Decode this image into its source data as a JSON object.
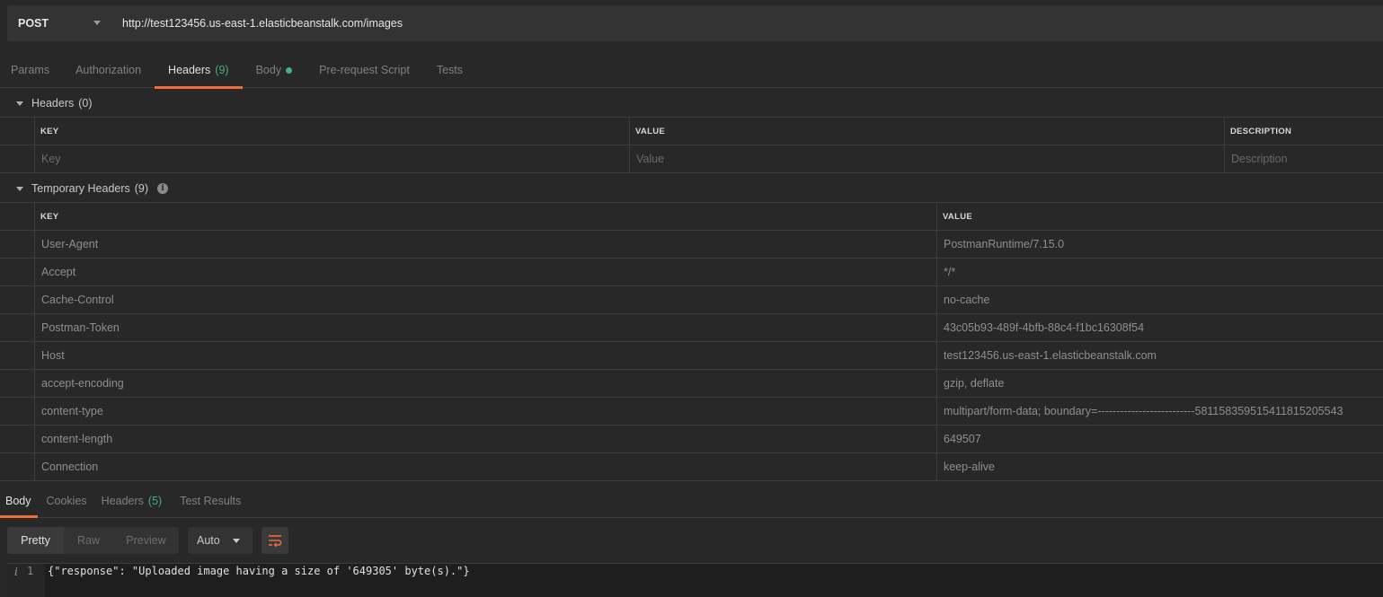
{
  "request": {
    "method": "POST",
    "url": "http://test123456.us-east-1.elasticbeanstalk.com/images"
  },
  "request_tabs": [
    {
      "label": "Params"
    },
    {
      "label": "Authorization"
    },
    {
      "label": "Headers",
      "count": "(9)",
      "active": true
    },
    {
      "label": "Body",
      "indicator": "green-dot"
    },
    {
      "label": "Pre-request Script"
    },
    {
      "label": "Tests"
    }
  ],
  "headers_section": {
    "title": "Headers",
    "count": "(0)",
    "columns": [
      "KEY",
      "VALUE",
      "DESCRIPTION"
    ],
    "placeholders": {
      "key": "Key",
      "value": "Value",
      "description": "Description"
    }
  },
  "temp_headers_section": {
    "title": "Temporary Headers",
    "count": "(9)",
    "info_icon": "info-icon",
    "columns": [
      "KEY",
      "VALUE"
    ],
    "rows": [
      {
        "key": "User-Agent",
        "value": "PostmanRuntime/7.15.0"
      },
      {
        "key": "Accept",
        "value": "*/*"
      },
      {
        "key": "Cache-Control",
        "value": "no-cache"
      },
      {
        "key": "Postman-Token",
        "value": "43c05b93-489f-4bfb-88c4-f1bc16308f54"
      },
      {
        "key": "Host",
        "value": "test123456.us-east-1.elasticbeanstalk.com"
      },
      {
        "key": "accept-encoding",
        "value": "gzip, deflate"
      },
      {
        "key": "content-type",
        "value": "multipart/form-data; boundary=--------------------------581158359515411815205543"
      },
      {
        "key": "content-length",
        "value": "649507"
      },
      {
        "key": "Connection",
        "value": "keep-alive"
      }
    ]
  },
  "response_tabs": [
    {
      "label": "Body",
      "active": true
    },
    {
      "label": "Cookies"
    },
    {
      "label": "Headers",
      "count": "(5)"
    },
    {
      "label": "Test Results"
    }
  ],
  "response_toolbar": {
    "views": [
      "Pretty",
      "Raw",
      "Preview"
    ],
    "active_view": "Pretty",
    "format": "Auto",
    "wrap_icon": "wrap-lines-icon"
  },
  "response_body": {
    "line_marker": "i",
    "line_number": "1",
    "line": "{\"response\": \"Uploaded image having a size of '649305' byte(s).\"}"
  },
  "colors": {
    "accent": "#f26b3a",
    "count_green": "#3fb37f",
    "background": "#282828",
    "panel": "#333333"
  }
}
